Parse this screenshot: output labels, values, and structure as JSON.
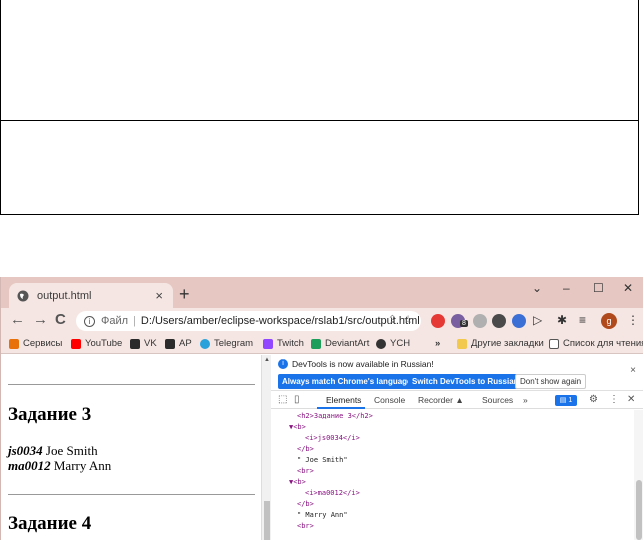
{
  "browser": {
    "tab_title": "output.html",
    "tab_close": "×",
    "new_tab": "+",
    "window_controls": {
      "chevron": "⌄",
      "minimize": "–",
      "maximize": "☐",
      "close": "✕"
    },
    "nav": {
      "back": "←",
      "forward": "→",
      "reload": "C"
    },
    "address": {
      "scheme": "Файл",
      "separator": "|",
      "url": "D:/Users/amber/eclipse-workspace/rslab1/src/output.html",
      "info_glyph": "i"
    },
    "profile_initial": "g",
    "menu_glyph": "⋮",
    "extension_badge": "8"
  },
  "bookmarks": {
    "items": [
      {
        "label": "Сервисы",
        "icon": "apps-icon",
        "color": "#e8710a"
      },
      {
        "label": "YouTube",
        "icon": "youtube-icon",
        "color": "#ff0000"
      },
      {
        "label": "VK",
        "icon": "vk-icon",
        "color": "#2b2b2b"
      },
      {
        "label": "AP",
        "icon": "ap-icon",
        "color": "#2b2b2b"
      },
      {
        "label": "Telegram",
        "icon": "telegram-icon",
        "color": "#2aa1da"
      },
      {
        "label": "Twitch",
        "icon": "twitch-icon",
        "color": "#9146ff"
      },
      {
        "label": "DeviantArt",
        "icon": "deviantart-icon",
        "color": "#1d9e5a"
      },
      {
        "label": "YCH",
        "icon": "ych-icon",
        "color": "#333333"
      }
    ],
    "overflow": "»",
    "other_bookmarks": "Другие закладки",
    "reading_list": "Список для чтения"
  },
  "page": {
    "heading_3": "Задание 3",
    "entry1_id": "js0034",
    "entry1_name": "Joe Smith",
    "entry2_id": "ma0012",
    "entry2_name": "Marry Ann",
    "heading_4": "Задание 4"
  },
  "devtools": {
    "notice": "DevTools is now available in Russian!",
    "btn_match": "Always match Chrome's language",
    "btn_switch": "Switch DevTools to Russian",
    "btn_dont_show": "Don't show again",
    "notice_close": "×",
    "tabs": {
      "elements": "Elements",
      "console": "Console",
      "recorder": "Recorder ▲",
      "sources": "Sources",
      "more": "»"
    },
    "message_count": "1",
    "dom_lines": [
      "<h2>Задание 3</h2>",
      "▼<b>",
      "<i>js0034</i>",
      "</b>",
      "\" Joe Smith\"",
      "<br>",
      "▼<b>",
      "<i>ma0012</i>",
      "</b>",
      "\" Marry Ann\"",
      "<br>"
    ]
  },
  "colors": {
    "accent": "#1a73e8",
    "chrome_frame": "#e6c7c2",
    "chrome_toolbar": "#f5e6e3"
  }
}
